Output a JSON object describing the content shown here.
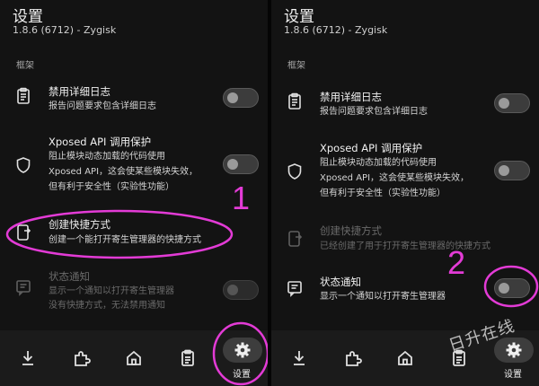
{
  "left": {
    "title": "设置",
    "subtitle": "1.8.6 (6712) - Zygisk",
    "section": "框架",
    "rows": [
      {
        "label": "禁用详细日志",
        "desc1": "报告问题要求包含详细日志",
        "desc2": ""
      },
      {
        "label": "Xposed API 调用保护",
        "desc1": "阻止模块动态加载的代码使用",
        "desc2": "Xposed API，这会使某些模块失效，",
        "desc3": "但有利于安全性（实验性功能）"
      },
      {
        "label": "创建快捷方式",
        "desc1": "创建一个能打开寄生管理器的快捷方式"
      },
      {
        "label": "状态通知",
        "desc1": "显示一个通知以打开寄生管理器",
        "desc2": "没有快捷方式，无法禁用通知"
      }
    ],
    "nav_active_label": "设置",
    "annotation_number": "1"
  },
  "right": {
    "title": "设置",
    "subtitle": "1.8.6 (6712) - Zygisk",
    "section": "框架",
    "rows": [
      {
        "label": "禁用详细日志",
        "desc1": "报告问题要求包含详细日志"
      },
      {
        "label": "Xposed API 调用保护",
        "desc1": "阻止模块动态加载的代码使用",
        "desc2": "Xposed API，这会使某些模块失效，",
        "desc3": "但有利于安全性（实验性功能）"
      },
      {
        "label": "创建快捷方式",
        "desc1": "已经创建了用于打开寄生管理器的快捷方式"
      },
      {
        "label": "状态通知",
        "desc1": "显示一个通知以打开寄生管理器"
      }
    ],
    "nav_active_label": "设置",
    "annotation_number": "2"
  },
  "watermark": "日升在线",
  "colors": {
    "annotation": "#e33bd6",
    "background": "#131313",
    "nav": "#1b1b1b"
  },
  "icons": [
    "clipboard-icon",
    "shield-icon",
    "shortcut-icon",
    "notification-icon",
    "download-icon",
    "puzzle-icon",
    "home-icon",
    "log-icon",
    "gear-icon"
  ]
}
